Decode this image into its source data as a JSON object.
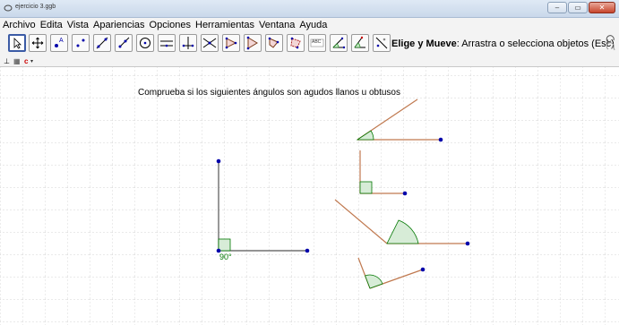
{
  "window": {
    "title": "ejercicio 3.ggb",
    "controls": {
      "minimize": "–",
      "maximize": "▭",
      "close": "✕"
    }
  },
  "menu": [
    "Archivo",
    "Edita",
    "Vista",
    "Apariencias",
    "Opciones",
    "Herramientas",
    "Ventana",
    "Ayuda"
  ],
  "toolbar": {
    "tools": [
      "move-tool-icon",
      "move-graphics-view-icon",
      "new-point-icon",
      "line-through-points-icon",
      "segment-icon",
      "ray-icon",
      "circle-icon",
      "parallel-line-icon",
      "perpendicular-bisector-icon",
      "intersect-icon",
      "polygon-icon",
      "regular-polygon-icon",
      "rigid-polygon-icon",
      "vector-polygon-icon",
      "text-icon",
      "angle-icon",
      "angle-given-size-icon",
      "reflect-icon",
      "translate-icon"
    ],
    "text_tool_label": "ABC",
    "desc_bold": "Elige y Mueve",
    "desc_rest": ": Arrastra o selecciona objetos (Esc)"
  },
  "stylebar": {
    "axes_glyph": "⊥",
    "grid_glyph": "▦",
    "color_glyph": "c"
  },
  "canvas": {
    "heading": "Comprueba si los siguientes ángulos son agudos llanos u obtusos",
    "angle_label": "90°"
  },
  "colors": {
    "segment": "#c0794f",
    "segment_dark": "#555555",
    "point": "#0000aa",
    "angle_fill": "#d7ecd7",
    "angle_stroke": "#007700",
    "grid": "#c8c8c8",
    "active_tool_border": "#3b5ba5"
  }
}
